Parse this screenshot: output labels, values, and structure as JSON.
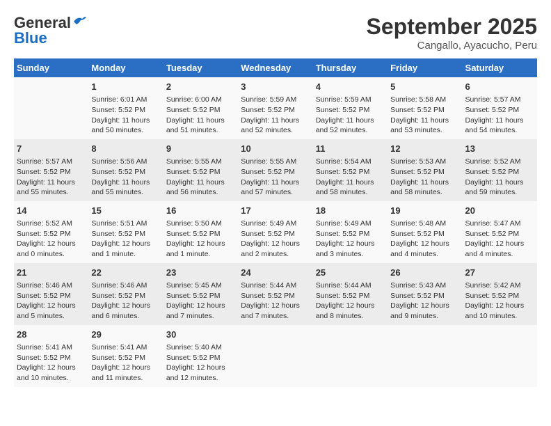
{
  "header": {
    "logo_general": "General",
    "logo_blue": "Blue",
    "month_title": "September 2025",
    "subtitle": "Cangallo, Ayacucho, Peru"
  },
  "days_of_week": [
    "Sunday",
    "Monday",
    "Tuesday",
    "Wednesday",
    "Thursday",
    "Friday",
    "Saturday"
  ],
  "weeks": [
    [
      {
        "day": "",
        "info": ""
      },
      {
        "day": "1",
        "info": "Sunrise: 6:01 AM\nSunset: 5:52 PM\nDaylight: 11 hours\nand 50 minutes."
      },
      {
        "day": "2",
        "info": "Sunrise: 6:00 AM\nSunset: 5:52 PM\nDaylight: 11 hours\nand 51 minutes."
      },
      {
        "day": "3",
        "info": "Sunrise: 5:59 AM\nSunset: 5:52 PM\nDaylight: 11 hours\nand 52 minutes."
      },
      {
        "day": "4",
        "info": "Sunrise: 5:59 AM\nSunset: 5:52 PM\nDaylight: 11 hours\nand 52 minutes."
      },
      {
        "day": "5",
        "info": "Sunrise: 5:58 AM\nSunset: 5:52 PM\nDaylight: 11 hours\nand 53 minutes."
      },
      {
        "day": "6",
        "info": "Sunrise: 5:57 AM\nSunset: 5:52 PM\nDaylight: 11 hours\nand 54 minutes."
      }
    ],
    [
      {
        "day": "7",
        "info": "Sunrise: 5:57 AM\nSunset: 5:52 PM\nDaylight: 11 hours\nand 55 minutes."
      },
      {
        "day": "8",
        "info": "Sunrise: 5:56 AM\nSunset: 5:52 PM\nDaylight: 11 hours\nand 55 minutes."
      },
      {
        "day": "9",
        "info": "Sunrise: 5:55 AM\nSunset: 5:52 PM\nDaylight: 11 hours\nand 56 minutes."
      },
      {
        "day": "10",
        "info": "Sunrise: 5:55 AM\nSunset: 5:52 PM\nDaylight: 11 hours\nand 57 minutes."
      },
      {
        "day": "11",
        "info": "Sunrise: 5:54 AM\nSunset: 5:52 PM\nDaylight: 11 hours\nand 58 minutes."
      },
      {
        "day": "12",
        "info": "Sunrise: 5:53 AM\nSunset: 5:52 PM\nDaylight: 11 hours\nand 58 minutes."
      },
      {
        "day": "13",
        "info": "Sunrise: 5:52 AM\nSunset: 5:52 PM\nDaylight: 11 hours\nand 59 minutes."
      }
    ],
    [
      {
        "day": "14",
        "info": "Sunrise: 5:52 AM\nSunset: 5:52 PM\nDaylight: 12 hours\nand 0 minutes."
      },
      {
        "day": "15",
        "info": "Sunrise: 5:51 AM\nSunset: 5:52 PM\nDaylight: 12 hours\nand 1 minute."
      },
      {
        "day": "16",
        "info": "Sunrise: 5:50 AM\nSunset: 5:52 PM\nDaylight: 12 hours\nand 1 minute."
      },
      {
        "day": "17",
        "info": "Sunrise: 5:49 AM\nSunset: 5:52 PM\nDaylight: 12 hours\nand 2 minutes."
      },
      {
        "day": "18",
        "info": "Sunrise: 5:49 AM\nSunset: 5:52 PM\nDaylight: 12 hours\nand 3 minutes."
      },
      {
        "day": "19",
        "info": "Sunrise: 5:48 AM\nSunset: 5:52 PM\nDaylight: 12 hours\nand 4 minutes."
      },
      {
        "day": "20",
        "info": "Sunrise: 5:47 AM\nSunset: 5:52 PM\nDaylight: 12 hours\nand 4 minutes."
      }
    ],
    [
      {
        "day": "21",
        "info": "Sunrise: 5:46 AM\nSunset: 5:52 PM\nDaylight: 12 hours\nand 5 minutes."
      },
      {
        "day": "22",
        "info": "Sunrise: 5:46 AM\nSunset: 5:52 PM\nDaylight: 12 hours\nand 6 minutes."
      },
      {
        "day": "23",
        "info": "Sunrise: 5:45 AM\nSunset: 5:52 PM\nDaylight: 12 hours\nand 7 minutes."
      },
      {
        "day": "24",
        "info": "Sunrise: 5:44 AM\nSunset: 5:52 PM\nDaylight: 12 hours\nand 7 minutes."
      },
      {
        "day": "25",
        "info": "Sunrise: 5:44 AM\nSunset: 5:52 PM\nDaylight: 12 hours\nand 8 minutes."
      },
      {
        "day": "26",
        "info": "Sunrise: 5:43 AM\nSunset: 5:52 PM\nDaylight: 12 hours\nand 9 minutes."
      },
      {
        "day": "27",
        "info": "Sunrise: 5:42 AM\nSunset: 5:52 PM\nDaylight: 12 hours\nand 10 minutes."
      }
    ],
    [
      {
        "day": "28",
        "info": "Sunrise: 5:41 AM\nSunset: 5:52 PM\nDaylight: 12 hours\nand 10 minutes."
      },
      {
        "day": "29",
        "info": "Sunrise: 5:41 AM\nSunset: 5:52 PM\nDaylight: 12 hours\nand 11 minutes."
      },
      {
        "day": "30",
        "info": "Sunrise: 5:40 AM\nSunset: 5:52 PM\nDaylight: 12 hours\nand 12 minutes."
      },
      {
        "day": "",
        "info": ""
      },
      {
        "day": "",
        "info": ""
      },
      {
        "day": "",
        "info": ""
      },
      {
        "day": "",
        "info": ""
      }
    ]
  ]
}
